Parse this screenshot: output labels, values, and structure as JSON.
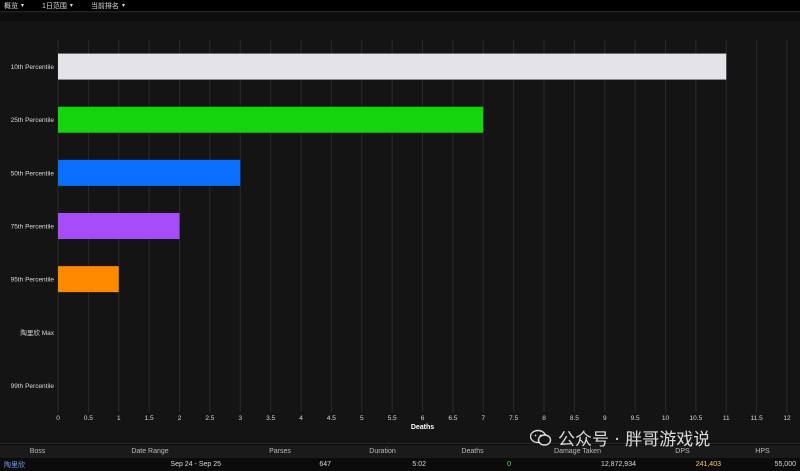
{
  "topbar": {
    "menus": [
      {
        "label": "概览"
      },
      {
        "label": "1日范围"
      },
      {
        "label": "当前排名"
      }
    ]
  },
  "colors": {
    "background": "#141414",
    "grid": "#2a2a2a",
    "text": "#d8d8d8"
  },
  "chart_data": {
    "type": "bar",
    "orientation": "horizontal",
    "categories": [
      "10th Percentile",
      "25th Percentile",
      "50th Percentile",
      "75th Percentile",
      "95th Percentile",
      "陶里欣 Max",
      "99th Percentile"
    ],
    "values": [
      11,
      7,
      3,
      2,
      1,
      null,
      null
    ],
    "bar_colors": [
      "#e3e3e8",
      "#14d40c",
      "#0a70ff",
      "#a64df7",
      "#ff8a00",
      null,
      null
    ],
    "xlabel": "Deaths",
    "xlim": [
      0,
      12
    ],
    "xticks": [
      0,
      0.5,
      1,
      1.5,
      2,
      2.5,
      3,
      3.5,
      4,
      4.5,
      5,
      5.5,
      6,
      6.5,
      7,
      7.5,
      8,
      8.5,
      9,
      9.5,
      10,
      10.5,
      11,
      11.5,
      12
    ],
    "grid": true,
    "legend": "none"
  },
  "table": {
    "headers": [
      "Boss",
      "Date Range",
      "Parses",
      "Duration",
      "Deaths",
      "Damage Taken",
      "DPS",
      "HPS"
    ],
    "row": [
      "陶里欣",
      "Sep 24 - Sep 25",
      "647",
      "5:02",
      "0",
      "12,872,934",
      "241,403",
      "55,000"
    ]
  },
  "watermark": {
    "text": "公众号 · 胖哥游戏说"
  }
}
